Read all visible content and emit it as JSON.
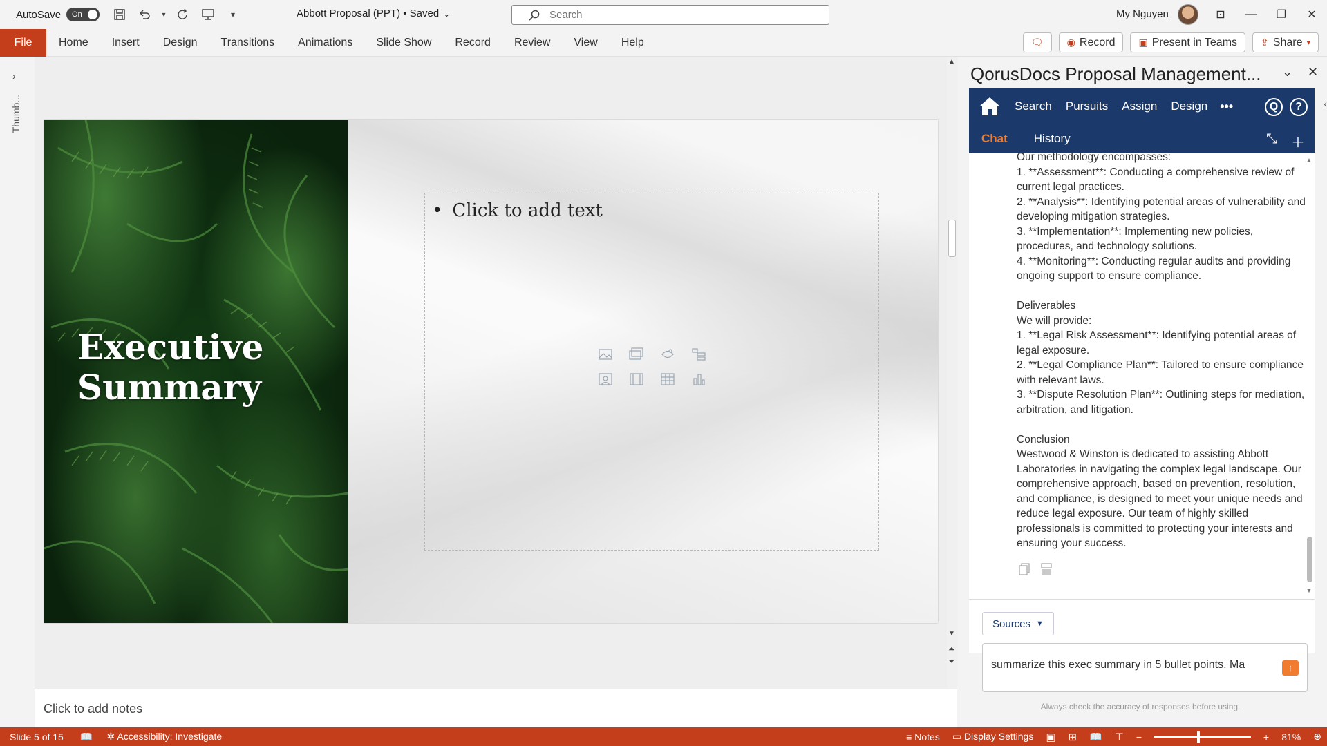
{
  "titlebar": {
    "autosave_label": "AutoSave",
    "autosave_state": "On",
    "document_title": "Abbott Proposal (PPT) • Saved",
    "search_placeholder": "Search",
    "user_name": "My Nguyen"
  },
  "ribbon": {
    "file": "File",
    "tabs": [
      "Home",
      "Insert",
      "Design",
      "Transitions",
      "Animations",
      "Slide Show",
      "Record",
      "Review",
      "View",
      "Help"
    ],
    "record": "Record",
    "present_in_teams": "Present in Teams",
    "share": "Share"
  },
  "thumbnails": {
    "label": "Thumb..."
  },
  "slide": {
    "title": "Executive Summary",
    "placeholder_text": "Click to add text"
  },
  "notes": {
    "placeholder": "Click to add notes"
  },
  "pane": {
    "title": "QorusDocs Proposal Management...",
    "nav": {
      "search": "Search",
      "pursuits": "Pursuits",
      "assign": "Assign",
      "design": "Design",
      "more": "•••"
    },
    "tabs": {
      "chat": "Chat",
      "history": "History"
    },
    "message_lines": [
      "Our methodology encompasses:",
      "1. **Assessment**: Conducting a comprehensive review of current legal practices.",
      "2. **Analysis**: Identifying potential areas of vulnerability and developing mitigation strategies.",
      "3. **Implementation**: Implementing new policies, procedures, and technology solutions.",
      "4. **Monitoring**: Conducting regular audits and providing ongoing support to ensure compliance.",
      "",
      "Deliverables",
      "We will provide:",
      "1. **Legal Risk Assessment**: Identifying potential areas of legal exposure.",
      "2. **Legal Compliance Plan**: Tailored to ensure compliance with relevant laws.",
      "3. **Dispute Resolution Plan**: Outlining steps for mediation, arbitration, and litigation.",
      "",
      "Conclusion",
      "Westwood & Winston is dedicated to assisting Abbott Laboratories in navigating the complex legal landscape. Our comprehensive approach, based on prevention, resolution, and compliance, is designed to meet your unique needs and reduce legal exposure. Our team of highly skilled professionals is committed to protecting your interests and ensuring your success."
    ],
    "sources": "Sources",
    "prompt_value": "summarize this exec summary in 5 bullet points. Ma",
    "disclaimer": "Always check the accuracy of responses before using."
  },
  "status": {
    "slide_info": "Slide 5 of 15",
    "accessibility": "Accessibility: Investigate",
    "notes": "Notes",
    "display_settings": "Display Settings",
    "zoom": "81%"
  },
  "colors": {
    "accent": "#c43e1c",
    "qorus_nav": "#1b3a6b",
    "qorus_accent": "#f17b2e"
  }
}
